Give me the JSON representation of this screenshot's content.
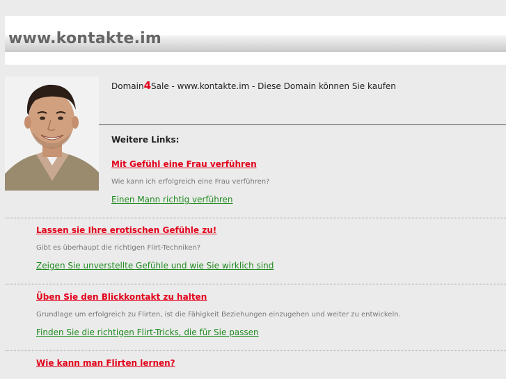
{
  "header": {
    "site_title": "www.kontakte.im"
  },
  "intro": {
    "sale_prefix": "Domain",
    "sale_four": "4",
    "sale_suffix": "Sale - www.kontakte.im - Diese Domain können Sie kaufen",
    "more_links_label": "Weitere Links:"
  },
  "top_block": {
    "title": "Mit Gefühl eine Frau verführen",
    "desc": "Wie kann ich erfolgreich eine Frau verführen?",
    "link": "Einen Mann richtig verführen"
  },
  "blocks": [
    {
      "title": "Lassen sie Ihre erotischen Gefühle zu!",
      "desc": "Gibt es überhaupt die richtigen Flirt-Techniken?",
      "link": "Zeigen Sie unverstellte Gefühle und wie Sie wirklich sind"
    },
    {
      "title": "Üben Sie den Blickkontakt zu halten",
      "desc": "Grundlage um erfolgreich zu Flirten, ist die Fähigkeit Beziehungen einzugehen und weiter zu entwickeln.",
      "link": "Finden Sie die richtigen Flirt-Tricks, die für Sie passen"
    },
    {
      "title": "Wie kann man Flirten lernen?"
    }
  ],
  "colors": {
    "red_link": "#e2001a",
    "green_link": "#1f8a1f",
    "background": "#ebebeb"
  },
  "icons": {
    "photo": "man-portrait-photo"
  }
}
